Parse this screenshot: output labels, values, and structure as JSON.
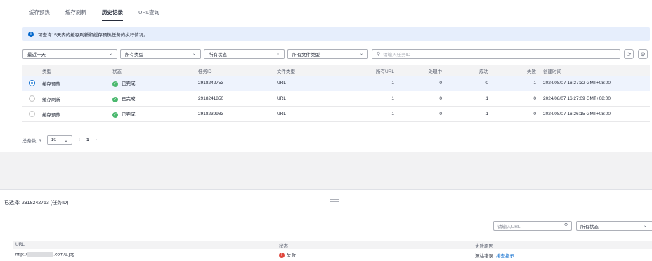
{
  "tabs": [
    {
      "label": "缓存预热"
    },
    {
      "label": "缓存刷新"
    },
    {
      "label": "历史记录"
    },
    {
      "label": "URL查询"
    }
  ],
  "banner": {
    "text": "可查询15天内的缓存刷新和缓存预热任务的执行情况。"
  },
  "filters": {
    "time": "最近一天",
    "type": "所有类型",
    "status": "所有状态",
    "file_type": "所有文件类型",
    "search_placeholder": "请输入任务ID"
  },
  "table": {
    "headers": {
      "type": "类型",
      "status": "状态",
      "task_id": "任务ID",
      "file_type": "文件类型",
      "all_url": "所有URL",
      "processing": "处理中",
      "success": "成功",
      "failed": "失败",
      "created": "创建时间"
    },
    "rows": [
      {
        "type": "缓存预热",
        "status": "已完成",
        "task_id": "2918242753",
        "file_type": "URL",
        "all_url": "1",
        "processing": "0",
        "success": "0",
        "failed": "1",
        "created": "2024/08/07 16:27:32 GMT+08:00"
      },
      {
        "type": "缓存刷新",
        "status": "已完成",
        "task_id": "2918241850",
        "file_type": "URL",
        "all_url": "1",
        "processing": "0",
        "success": "1",
        "failed": "0",
        "created": "2024/08/07 16:27:09 GMT+08:00"
      },
      {
        "type": "缓存预热",
        "status": "已完成",
        "task_id": "2918239983",
        "file_type": "URL",
        "all_url": "1",
        "processing": "0",
        "success": "1",
        "failed": "0",
        "created": "2024/08/07 16:26:15 GMT+08:00"
      }
    ]
  },
  "pager": {
    "total_label": "总条数: 3",
    "page_size": "10",
    "current_page": "1"
  },
  "detail": {
    "selected_label": "已选择: 2918242753 (任务ID)",
    "url_placeholder": "请输入URL",
    "status_filter": "所有状态",
    "headers": {
      "url": "URL",
      "status": "状态",
      "reason": "失败原因"
    },
    "row": {
      "url_prefix": "http://",
      "url_suffix": ".com/1.jpg",
      "status": "失败",
      "reason": "源站错误",
      "link": "排查指示"
    }
  },
  "colors": {
    "accent": "#0066cc",
    "success": "#4ab86e",
    "error": "#e0473d"
  }
}
